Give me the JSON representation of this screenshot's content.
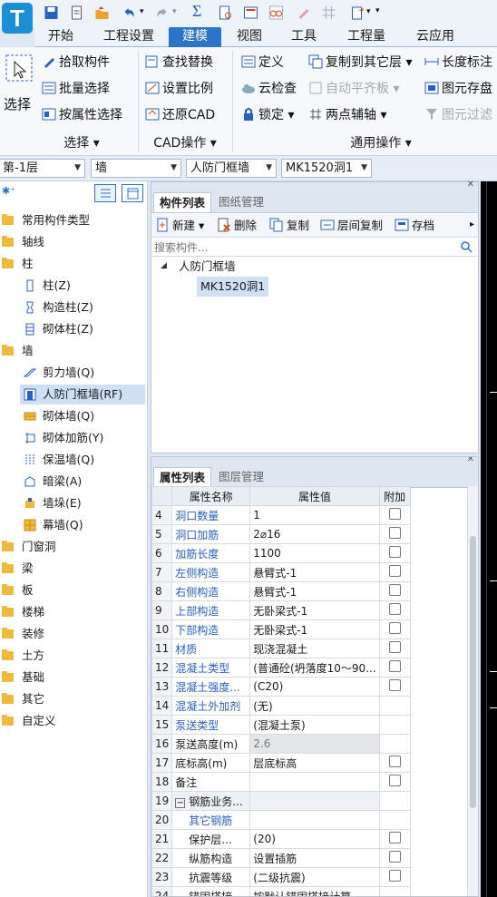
{
  "ribbon_tabs": [
    "开始",
    "工程设置",
    "建模",
    "视图",
    "工具",
    "工程量",
    "云应用"
  ],
  "ribbon": {
    "select_big": "选择",
    "pick": "拾取构件",
    "batch": "批量选择",
    "by_attr": "按属性选择",
    "find_replace": "查找替换",
    "set_scale": "设置比例",
    "restore_cad": "还原CAD",
    "define": "定义",
    "cloud_check": "云检查",
    "lock": "锁定",
    "copy_to_floor": "复制到其它层",
    "auto_align": "自动平齐板",
    "two_point_axis": "两点辅轴",
    "length_mark": "长度标注",
    "save_element": "图元存盘",
    "filter_element": "图元过滤",
    "group_select": "选择",
    "group_cad": "CAD操作",
    "group_general": "通用操作"
  },
  "toolbar": {
    "floor": "第-1层",
    "category": "墙",
    "subtype": "人防门框墙",
    "item": "MK1520洞1"
  },
  "tree": {
    "top": [
      "常用构件类型",
      "轴线",
      "柱"
    ],
    "column_children": [
      "柱(Z)",
      "构造柱(Z)",
      "砌体柱(Z)"
    ],
    "wall": "墙",
    "wall_children": [
      "剪力墙(Q)",
      "人防门框墙(RF)",
      "砌体墙(Q)",
      "砌体加筋(Y)",
      "保温墙(Q)",
      "暗梁(A)",
      "墙垛(E)",
      "幕墙(Q)"
    ],
    "rest": [
      "门窗洞",
      "梁",
      "板",
      "楼梯",
      "装修",
      "土方",
      "基础",
      "其它",
      "自定义"
    ]
  },
  "component_panel": {
    "tab_active": "构件列表",
    "tab_inactive": "图纸管理",
    "new": "新建",
    "delete": "删除",
    "copy": "复制",
    "floor_copy": "层间复制",
    "archive": "存档",
    "search_placeholder": "搜索构件...",
    "root": "人防门框墙",
    "child": "MK1520洞1"
  },
  "props_panel": {
    "tab_active": "属性列表",
    "tab_inactive": "图层管理",
    "col_name": "属性名称",
    "col_value": "属性值",
    "col_add": "附加",
    "rows": [
      {
        "n": "4",
        "name": "洞口数量",
        "value": "1",
        "link": true,
        "chk": true
      },
      {
        "n": "5",
        "name": "洞口加筋",
        "value": "2⌀16",
        "link": true,
        "chk": true
      },
      {
        "n": "6",
        "name": "加筋长度",
        "value": "1100",
        "link": true,
        "chk": true
      },
      {
        "n": "7",
        "name": "左侧构造",
        "value": "悬臂式-1",
        "link": true,
        "chk": true
      },
      {
        "n": "8",
        "name": "右侧构造",
        "value": "悬臂式-1",
        "link": true,
        "chk": true
      },
      {
        "n": "9",
        "name": "上部构造",
        "value": "无卧梁式-1",
        "link": true,
        "chk": true
      },
      {
        "n": "10",
        "name": "下部构造",
        "value": "无卧梁式-1",
        "link": true,
        "chk": true
      },
      {
        "n": "11",
        "name": "材质",
        "value": "现浇混凝土",
        "link": true,
        "chk": true
      },
      {
        "n": "12",
        "name": "混凝土类型",
        "value": "(普通砼(坍落度10～90...",
        "link": true,
        "chk": true
      },
      {
        "n": "13",
        "name": "混凝土强度...",
        "value": "(C20)",
        "link": true,
        "chk": true
      },
      {
        "n": "14",
        "name": "混凝土外加剂",
        "value": "(无)",
        "link": true,
        "chk": false
      },
      {
        "n": "15",
        "name": "泵送类型",
        "value": "(混凝土泵)",
        "link": true,
        "chk": false
      },
      {
        "n": "16",
        "name": "泵送高度(m)",
        "value": "2.6",
        "link": false,
        "chk": false,
        "grey": true
      },
      {
        "n": "17",
        "name": "底标高(m)",
        "value": "层底标高",
        "link": false,
        "chk": true
      },
      {
        "n": "18",
        "name": "备注",
        "value": "",
        "link": false,
        "chk": true
      },
      {
        "n": "19",
        "name": "钢筋业务...",
        "value": "",
        "link": false,
        "chk": false,
        "group": true
      },
      {
        "n": "20",
        "name": "其它钢筋",
        "value": "",
        "link": true,
        "chk": false,
        "indent": true
      },
      {
        "n": "21",
        "name": "保护层...",
        "value": "(20)",
        "link": false,
        "chk": true,
        "indent": true
      },
      {
        "n": "22",
        "name": "纵筋构造",
        "value": "设置插筋",
        "link": false,
        "chk": true,
        "indent": true
      },
      {
        "n": "23",
        "name": "抗震等级",
        "value": "(二级抗震)",
        "link": false,
        "chk": true,
        "indent": true
      },
      {
        "n": "24",
        "name": "锚固搭接",
        "value": "按默认锚固搭接计算",
        "link": false,
        "chk": false,
        "indent": true
      }
    ]
  },
  "colors": {
    "accent": "#2a74c9",
    "link": "#2a5fc4",
    "folder": "#f0b93b"
  }
}
